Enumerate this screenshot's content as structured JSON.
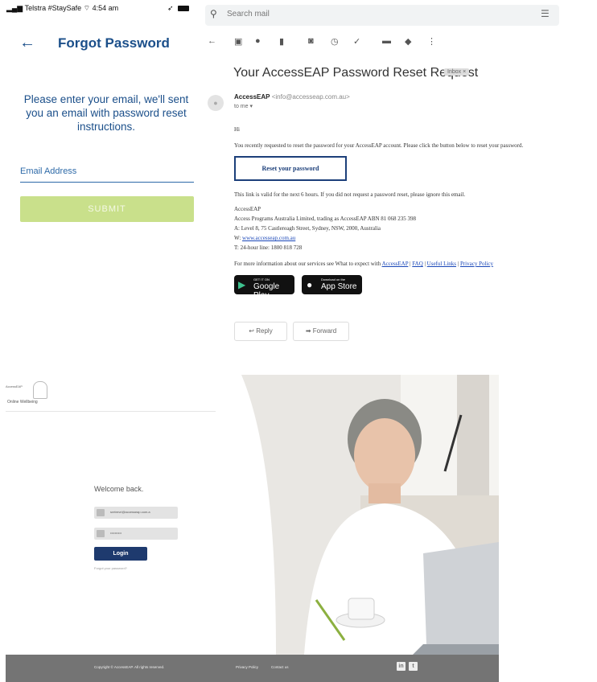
{
  "mobile": {
    "carrier": "Telstra #StaySafe",
    "time": "4:54 am",
    "title": "Forgot Password",
    "back_icon": "arrow-left-icon",
    "instructions": "Please enter your email, we'll sent you an email with password reset instructions.",
    "email_label": "Email Address",
    "submit_label": "SUBMIT",
    "colors": {
      "primary": "#1b4f8a",
      "submit_bg": "#c9e08b"
    }
  },
  "gmail": {
    "search_placeholder": "Search mail",
    "subject": "Your AccessEAP Password Reset Request",
    "inbox_badge": "Inbox ×",
    "sender_name": "AccessEAP",
    "sender_email": "<info@accesseap.com.au>",
    "to_me": "to me ▾",
    "greeting": "Hi",
    "body_intro": "You recently requested to reset the password for your AccessEAP account. Please click the button below to reset your password.",
    "reset_button": "Reset your password",
    "validity_note": "This link is valid for the next 6 hours. If you did not request a password reset, please ignore this email.",
    "signature": {
      "org": "AccessEAP",
      "legal": "Access Programs Australia Limited, trading as AccessEAP ABN 81 068 235 398",
      "address": "A: Level 8, 75 Castlereagh Street, Sydney, NSW, 2000, Australia",
      "web_prefix": "W: ",
      "web_link": "www.accesseap.com.au",
      "phone": "T: 24-hour line: 1800 818 728"
    },
    "more_info_prefix": "For more information about our services see What to expect with ",
    "links": [
      "AccessEAP",
      "FAQ",
      "Useful Links",
      "Privacy Policy"
    ],
    "store_buttons": {
      "google_small": "GET IT ON",
      "google_big": "Google Play",
      "apple_small": "Download on the",
      "apple_big": "App Store"
    },
    "reply_label": "Reply",
    "forward_label": "Forward"
  },
  "web": {
    "logo_text": "AccessEAP",
    "logo_sub": "Online Wellbeing",
    "welcome": "Welcome back.",
    "email_value": "sretrevri@accesseap.com.a",
    "password_value": "••••••••••",
    "login_label": "Login",
    "forgot_label": "Forgot your password?",
    "copyright": "Copyright © AccessEAP. All rights reserved.",
    "privacy_link": "Privacy Policy",
    "contact_link": "Contact us",
    "colors": {
      "login_bg": "#1e3a6e",
      "footer_bg": "#747474"
    }
  }
}
